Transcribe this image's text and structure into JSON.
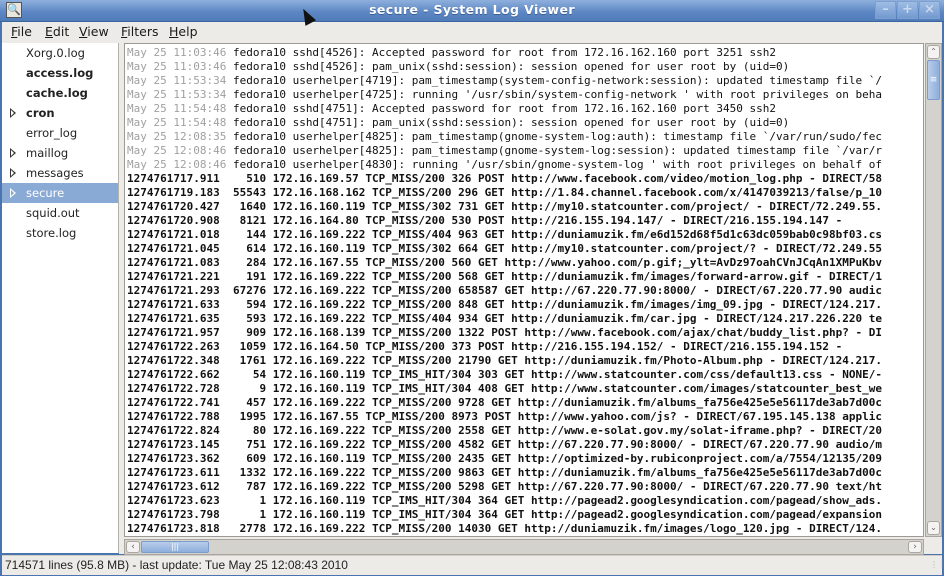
{
  "window": {
    "title": "secure - System Log Viewer",
    "controls": [
      "minimize",
      "maximize",
      "close"
    ]
  },
  "menubar": {
    "items": [
      {
        "label": "File",
        "mnemonic": "F"
      },
      {
        "label": "Edit",
        "mnemonic": "E"
      },
      {
        "label": "View",
        "mnemonic": "V"
      },
      {
        "label": "Filters",
        "mnemonic": "F"
      },
      {
        "label": "Help",
        "mnemonic": "H"
      }
    ]
  },
  "sidebar": {
    "items": [
      {
        "label": "Xorg.0.log",
        "bold": false,
        "expandable": false,
        "selected": false
      },
      {
        "label": "access.log",
        "bold": true,
        "expandable": false,
        "selected": false
      },
      {
        "label": "cache.log",
        "bold": true,
        "expandable": false,
        "selected": false
      },
      {
        "label": "cron",
        "bold": true,
        "expandable": true,
        "selected": false
      },
      {
        "label": "error_log",
        "bold": false,
        "expandable": false,
        "selected": false
      },
      {
        "label": "maillog",
        "bold": false,
        "expandable": true,
        "selected": false
      },
      {
        "label": "messages",
        "bold": false,
        "expandable": true,
        "selected": false
      },
      {
        "label": "secure",
        "bold": false,
        "expandable": true,
        "selected": true
      },
      {
        "label": "squid.out",
        "bold": false,
        "expandable": false,
        "selected": false
      },
      {
        "label": "store.log",
        "bold": false,
        "expandable": false,
        "selected": false
      }
    ]
  },
  "log": {
    "lines": [
      {
        "style": "plain",
        "ts": "May 25 11:03:46",
        "text": " fedora10 sshd[4526]: Accepted password for root from 172.16.162.160 port 3251 ssh2"
      },
      {
        "style": "plain",
        "ts": "May 25 11:03:46",
        "text": " fedora10 sshd[4526]: pam_unix(sshd:session): session opened for user root by (uid=0)"
      },
      {
        "style": "plain",
        "ts": "May 25 11:53:34",
        "text": " fedora10 userhelper[4719]: pam_timestamp(system-config-network:session): updated timestamp file `/"
      },
      {
        "style": "plain",
        "ts": "May 25 11:53:34",
        "text": " fedora10 userhelper[4725]: running '/usr/sbin/system-config-network ' with root privileges on beha"
      },
      {
        "style": "plain",
        "ts": "May 25 11:54:48",
        "text": " fedora10 sshd[4751]: Accepted password for root from 172.16.162.160 port 3450 ssh2"
      },
      {
        "style": "plain",
        "ts": "May 25 11:54:48",
        "text": " fedora10 sshd[4751]: pam_unix(sshd:session): session opened for user root by (uid=0)"
      },
      {
        "style": "plain",
        "ts": "May 25 12:08:35",
        "text": " fedora10 userhelper[4825]: pam_timestamp(gnome-system-log:auth): timestamp file `/var/run/sudo/fec"
      },
      {
        "style": "plain",
        "ts": "May 25 12:08:46",
        "text": " fedora10 userhelper[4825]: pam_timestamp(gnome-system-log:session): updated timestamp file `/var/r"
      },
      {
        "style": "plain",
        "ts": "May 25 12:08:46",
        "text": " fedora10 userhelper[4830]: running '/usr/sbin/gnome-system-log ' with root privileges on behalf of"
      },
      {
        "style": "bold",
        "ts": "",
        "text": "1274761717.911    510 172.16.169.57 TCP_MISS/200 326 POST http://www.facebook.com/video/motion_log.php - DIRECT/58"
      },
      {
        "style": "bold",
        "ts": "",
        "text": "1274761719.183  55543 172.16.168.162 TCP_MISS/200 296 GET http://1.84.channel.facebook.com/x/4147039213/false/p_10"
      },
      {
        "style": "bold",
        "ts": "",
        "text": "1274761720.427   1640 172.16.160.119 TCP_MISS/302 731 GET http://my10.statcounter.com/project/ - DIRECT/72.249.55."
      },
      {
        "style": "bold",
        "ts": "",
        "text": "1274761720.908   8121 172.16.164.80 TCP_MISS/200 530 POST http://216.155.194.147/ - DIRECT/216.155.194.147 -"
      },
      {
        "style": "bold",
        "ts": "",
        "text": "1274761721.018    144 172.16.169.222 TCP_MISS/404 963 GET http://duniamuzik.fm/e6d152d68f5d1c63dc059bab0c98bf03.cs"
      },
      {
        "style": "bold",
        "ts": "",
        "text": "1274761721.045    614 172.16.160.119 TCP_MISS/302 664 GET http://my10.statcounter.com/project/? - DIRECT/72.249.55"
      },
      {
        "style": "bold",
        "ts": "",
        "text": "1274761721.083    284 172.16.167.55 TCP_MISS/200 560 GET http://www.yahoo.com/p.gif;_ylt=AvDz97oahCVnJCqAn1XMPuKbv"
      },
      {
        "style": "bold",
        "ts": "",
        "text": "1274761721.221    191 172.16.169.222 TCP_MISS/200 568 GET http://duniamuzik.fm/images/forward-arrow.gif - DIRECT/1"
      },
      {
        "style": "bold",
        "ts": "",
        "text": "1274761721.293  67276 172.16.169.222 TCP_MISS/200 658587 GET http://67.220.77.90:8000/ - DIRECT/67.220.77.90 audic"
      },
      {
        "style": "bold",
        "ts": "",
        "text": "1274761721.633    594 172.16.169.222 TCP_MISS/200 848 GET http://duniamuzik.fm/images/img_09.jpg - DIRECT/124.217."
      },
      {
        "style": "bold",
        "ts": "",
        "text": "1274761721.635    593 172.16.169.222 TCP_MISS/404 934 GET http://duniamuzik.fm/car.jpg - DIRECT/124.217.226.220 te"
      },
      {
        "style": "bold",
        "ts": "",
        "text": "1274761721.957    909 172.16.168.139 TCP_MISS/200 1322 POST http://www.facebook.com/ajax/chat/buddy_list.php? - DI"
      },
      {
        "style": "bold",
        "ts": "",
        "text": "1274761722.263   1059 172.16.164.50 TCP_MISS/200 373 POST http://216.155.194.152/ - DIRECT/216.155.194.152 -"
      },
      {
        "style": "bold",
        "ts": "",
        "text": "1274761722.348   1761 172.16.169.222 TCP_MISS/200 21790 GET http://duniamuzik.fm/Photo-Album.php - DIRECT/124.217."
      },
      {
        "style": "bold",
        "ts": "",
        "text": "1274761722.662     54 172.16.160.119 TCP_IMS_HIT/304 303 GET http://www.statcounter.com/css/default13.css - NONE/-"
      },
      {
        "style": "bold",
        "ts": "",
        "text": "1274761722.728      9 172.16.160.119 TCP_IMS_HIT/304 408 GET http://www.statcounter.com/images/statcounter_best_we"
      },
      {
        "style": "bold",
        "ts": "",
        "text": "1274761722.741    457 172.16.169.222 TCP_MISS/200 9728 GET http://duniamuzik.fm/albums_fa756e425e5e56117de3ab7d00c"
      },
      {
        "style": "bold",
        "ts": "",
        "text": "1274761722.788   1995 172.16.167.55 TCP_MISS/200 8973 POST http://www.yahoo.com/js? - DIRECT/67.195.145.138 applic"
      },
      {
        "style": "bold",
        "ts": "",
        "text": "1274761722.824     80 172.16.169.222 TCP_MISS/200 2558 GET http://www.e-solat.gov.my/solat-iframe.php? - DIRECT/20"
      },
      {
        "style": "bold",
        "ts": "",
        "text": "1274761723.145    751 172.16.169.222 TCP_MISS/200 4582 GET http://67.220.77.90:8000/ - DIRECT/67.220.77.90 audio/m"
      },
      {
        "style": "bold",
        "ts": "",
        "text": "1274761723.362    609 172.16.160.119 TCP_MISS/200 2435 GET http://optimized-by.rubiconproject.com/a/7554/12135/209"
      },
      {
        "style": "bold",
        "ts": "",
        "text": "1274761723.611   1332 172.16.169.222 TCP_MISS/200 9863 GET http://duniamuzik.fm/albums_fa756e425e5e56117de3ab7d00c"
      },
      {
        "style": "bold",
        "ts": "",
        "text": "1274761723.612    787 172.16.169.222 TCP_MISS/200 5298 GET http://67.220.77.90:8000/ - DIRECT/67.220.77.90 text/ht"
      },
      {
        "style": "bold",
        "ts": "",
        "text": "1274761723.623      1 172.16.160.119 TCP_IMS_HIT/304 364 GET http://pagead2.googlesyndication.com/pagead/show_ads."
      },
      {
        "style": "bold",
        "ts": "",
        "text": "1274761723.798      1 172.16.160.119 TCP_IMS_HIT/304 364 GET http://pagead2.googlesyndication.com/pagead/expansion"
      },
      {
        "style": "bold",
        "ts": "",
        "text": "1274761723.818   2778 172.16.169.222 TCP_MISS/200 14030 GET http://duniamuzik.fm/images/logo_120.jpg - DIRECT/124."
      }
    ]
  },
  "scrollbars": {
    "vertical": {
      "position_fraction": 0.0
    },
    "horizontal": {
      "position_fraction": 0.0
    }
  },
  "statusbar": {
    "text": "714571 lines (95.8 MB) - last update: Tue May 25 12:08:43 2010"
  },
  "colors": {
    "titlebar": "#5e88c4",
    "selection": "#8aaad6",
    "old_timestamp": "#a0a0a0"
  }
}
